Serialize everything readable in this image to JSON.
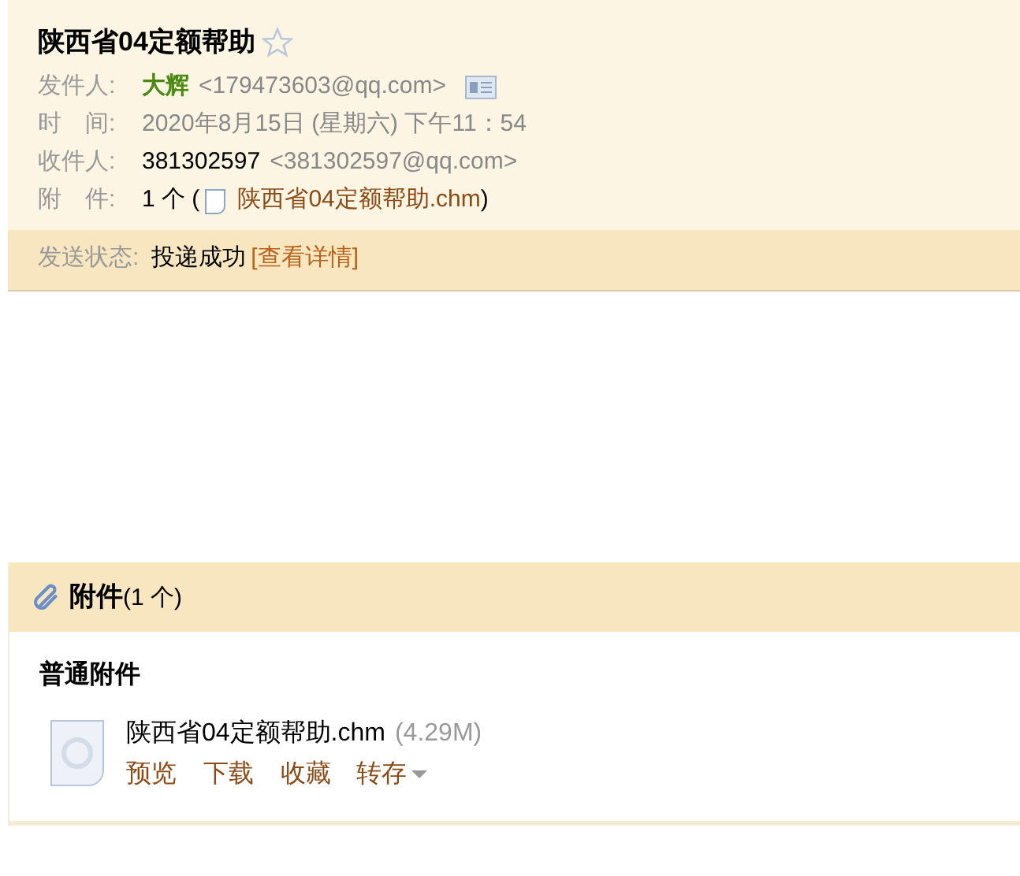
{
  "mail": {
    "subject": "陕西省04定额帮助",
    "starred": false,
    "fields": [
      {
        "kind": "sender",
        "label": "发件人:",
        "name": "大辉",
        "address": "<179473603@qq.com>"
      },
      {
        "kind": "time",
        "label": "时　间:",
        "value": "2020年8月15日 (星期六) 下午11：54"
      },
      {
        "kind": "recipient",
        "label": "收件人:",
        "name": "381302597",
        "address": "<381302597@qq.com>"
      },
      {
        "kind": "attachment",
        "label": "附　件:",
        "count": "1 个 (",
        "file": "陕西省04定额帮助.chm",
        "close": ")"
      }
    ],
    "status": {
      "label": "发送状态:",
      "value": "投递成功",
      "link": "[查看详情]"
    }
  },
  "attachments": {
    "title": "附件",
    "count": "(1 个)",
    "group": "普通附件",
    "files": [
      {
        "name": "陕西省04定额帮助.chm",
        "size": "(4.29M)",
        "actions": [
          {
            "kind": "link",
            "label": "预览"
          },
          {
            "kind": "link",
            "label": "下载"
          },
          {
            "kind": "link",
            "label": "收藏"
          },
          {
            "kind": "menu",
            "label": "转存"
          }
        ]
      }
    ]
  }
}
